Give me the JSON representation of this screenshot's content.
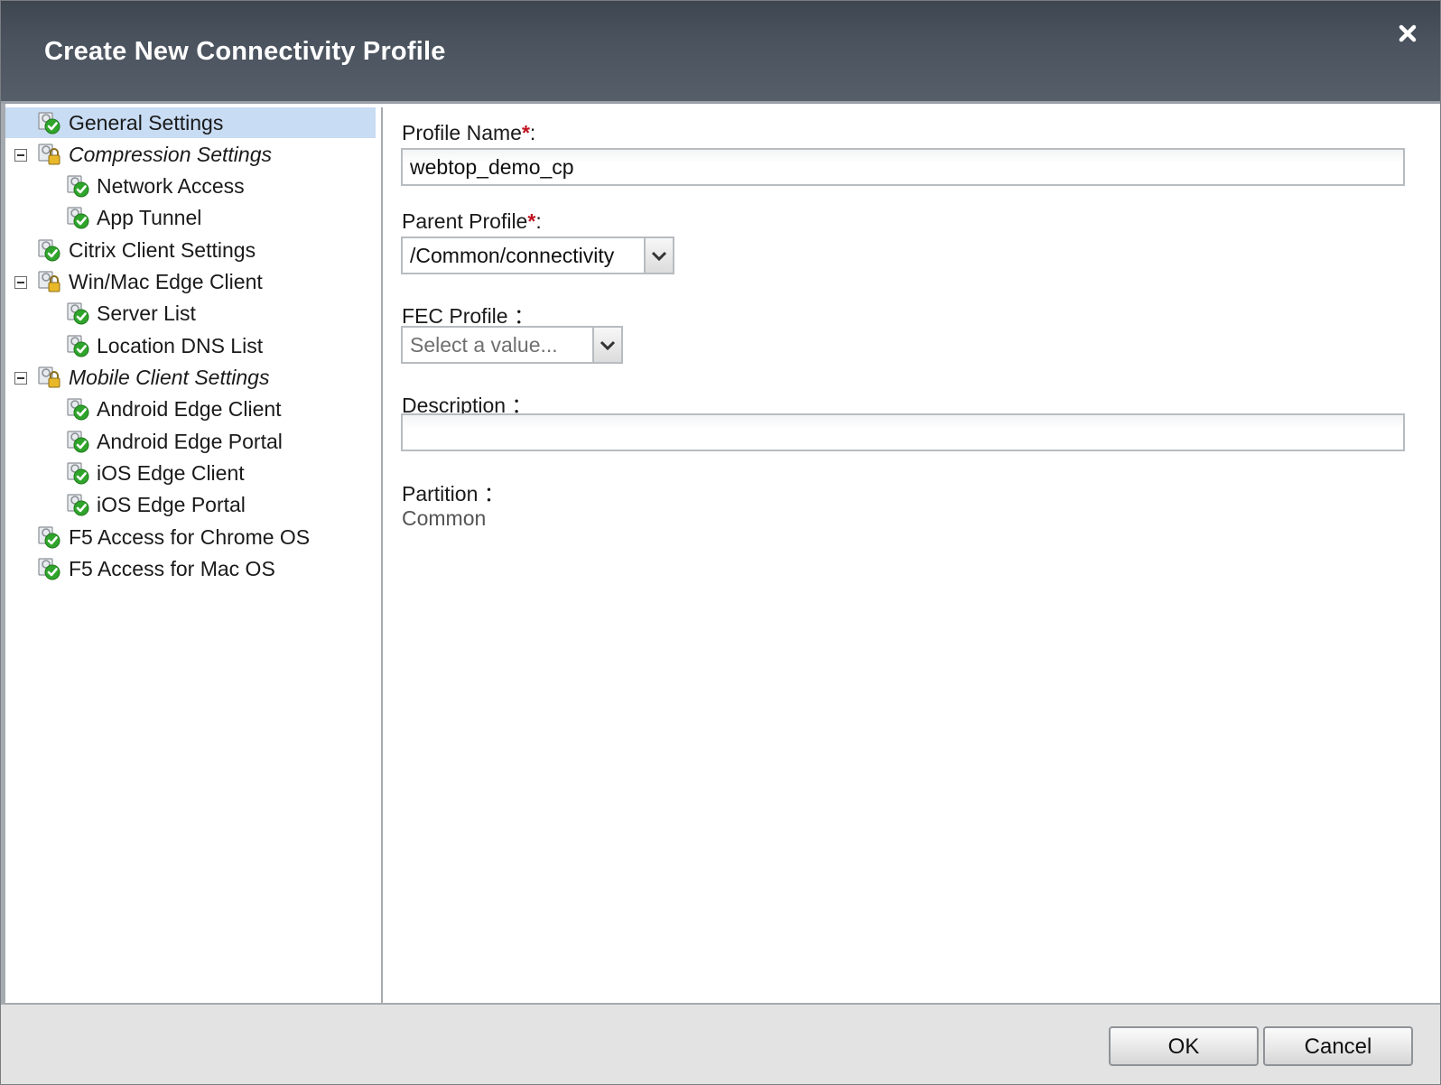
{
  "dialog": {
    "title": "Create New Connectivity Profile",
    "close_icon": "close-x-icon"
  },
  "tree": {
    "items": [
      {
        "label": "General Settings",
        "selected": true,
        "italic": false,
        "icon": "settings-check-icon"
      },
      {
        "label": "Compression Settings",
        "selected": false,
        "italic": true,
        "icon": "settings-lock-icon",
        "expandable": true,
        "expanded": true
      },
      {
        "label": "Network Access",
        "selected": false,
        "italic": false,
        "icon": "settings-check-icon"
      },
      {
        "label": "App Tunnel",
        "selected": false,
        "italic": false,
        "icon": "settings-check-icon"
      },
      {
        "label": "Citrix Client Settings",
        "selected": false,
        "italic": false,
        "icon": "settings-check-icon"
      },
      {
        "label": "Win/Mac Edge Client",
        "selected": false,
        "italic": false,
        "icon": "settings-lock-icon",
        "expandable": true,
        "expanded": true
      },
      {
        "label": "Server List",
        "selected": false,
        "italic": false,
        "icon": "settings-check-icon"
      },
      {
        "label": "Location DNS List",
        "selected": false,
        "italic": false,
        "icon": "settings-check-icon"
      },
      {
        "label": "Mobile Client Settings",
        "selected": false,
        "italic": true,
        "icon": "settings-lock-icon",
        "expandable": true,
        "expanded": true
      },
      {
        "label": "Android Edge Client",
        "selected": false,
        "italic": false,
        "icon": "settings-check-icon"
      },
      {
        "label": "Android Edge Portal",
        "selected": false,
        "italic": false,
        "icon": "settings-check-icon"
      },
      {
        "label": "iOS Edge Client",
        "selected": false,
        "italic": false,
        "icon": "settings-check-icon"
      },
      {
        "label": "iOS Edge Portal",
        "selected": false,
        "italic": false,
        "icon": "settings-check-icon"
      },
      {
        "label": "F5 Access for Chrome OS",
        "selected": false,
        "italic": false,
        "icon": "settings-check-icon"
      },
      {
        "label": "F5 Access for Mac OS",
        "selected": false,
        "italic": false,
        "icon": "settings-check-icon"
      }
    ]
  },
  "form": {
    "profile_name": {
      "label": "Profile Name",
      "required_mark": "*",
      "suffix": ":",
      "value": "webtop_demo_cp"
    },
    "parent_profile": {
      "label": "Parent Profile",
      "required_mark": "*",
      "suffix": ":",
      "value": "/Common/connectivity"
    },
    "fec_profile": {
      "label": "FEC Profile ：",
      "placeholder": "Select a value..."
    },
    "description": {
      "label": "Description ：",
      "value": ""
    },
    "partition": {
      "label": "Partition ：",
      "value": "Common"
    }
  },
  "footer": {
    "ok_label": "OK",
    "cancel_label": "Cancel"
  },
  "colors": {
    "title_bar": "#4a535e",
    "selected_row": "#c8dcf3",
    "required": "#c1121f",
    "check_green": "#2fa52b"
  }
}
